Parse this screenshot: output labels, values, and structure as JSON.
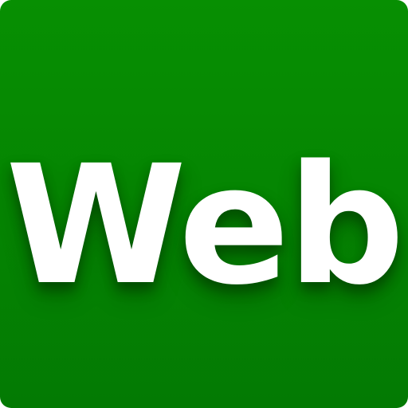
{
  "icon": {
    "label": "Web",
    "background_color": "#058602",
    "text_color": "#ffffff"
  }
}
